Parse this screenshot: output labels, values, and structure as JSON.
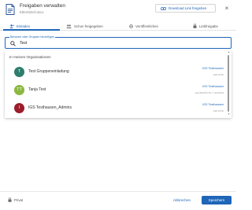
{
  "header": {
    "title": "Freigaben verwalten",
    "subtitle": "Elternbrief.docx",
    "download_link_label": "Download Link freigeben",
    "close_symbol": "×"
  },
  "tabs": [
    {
      "label": "Einladen",
      "icon": "person-add-icon",
      "active": true
    },
    {
      "label": "Schon freigegeben",
      "icon": "people-icon",
      "active": false
    },
    {
      "label": "Veröffentlichen",
      "icon": "globe-icon",
      "active": false
    },
    {
      "label": "Linkfreigabe",
      "icon": "lock-icon",
      "active": false
    }
  ],
  "search": {
    "label": "Benutzer oder Gruppen hinzufügen",
    "value": "Test"
  },
  "dropdown": {
    "section_title": "In meinen Organisationen",
    "results": [
      {
        "initial": "T",
        "name": "Test Gruppeneinladung",
        "org": "IGS Testhausen",
        "role": "GRUPPE",
        "color": "#2e7d6e"
      },
      {
        "initial": "TT",
        "name": "Tanja Test",
        "org": "IGS Testhausen",
        "role": "LEHRKRÄFTE / LEHRER",
        "color": "#8bb840"
      },
      {
        "initial": "I",
        "name": "IGS Testhausen_Admins",
        "org": "IGS Testhausen",
        "role": "GRUPPE",
        "color": "#9b1c2a"
      }
    ]
  },
  "footer": {
    "privat_label": "Privat",
    "cancel_label": "Abbrechen",
    "save_label": "Speichern"
  },
  "colors": {
    "accent": "#1f66b8"
  }
}
